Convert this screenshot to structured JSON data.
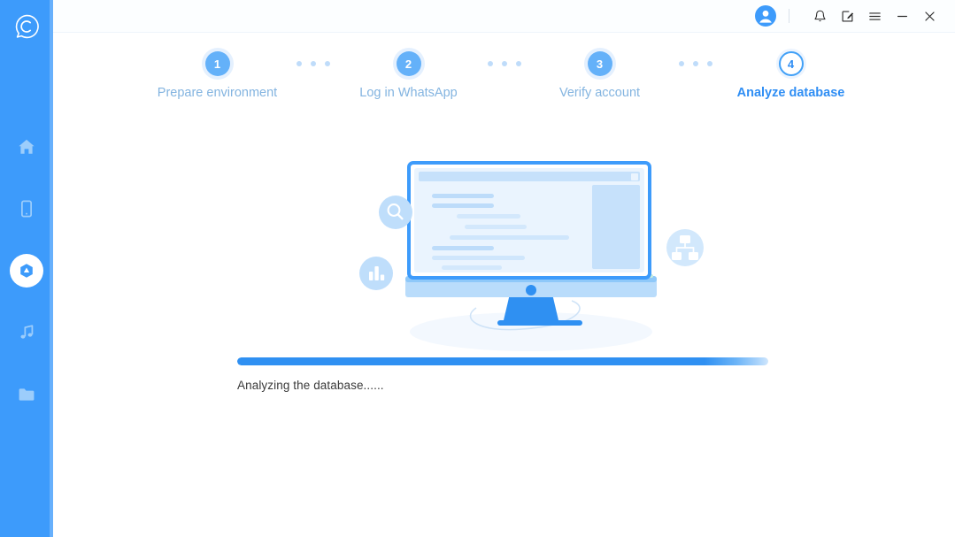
{
  "app": {
    "brand_icon": "chat-c-logo-icon",
    "accent_color": "#3d9bfb",
    "sidebar_color": "#3d9bfb"
  },
  "sidebar": {
    "items": [
      {
        "name": "home",
        "icon": "home-icon",
        "active": false
      },
      {
        "name": "device",
        "icon": "mobile-phone-icon",
        "active": false
      },
      {
        "name": "transfer",
        "icon": "droplet-shield-icon",
        "active": true
      },
      {
        "name": "music",
        "icon": "music-note-icon",
        "active": false
      },
      {
        "name": "files",
        "icon": "folder-icon",
        "active": false
      }
    ]
  },
  "titlebar": {
    "avatar_icon": "user-avatar-icon",
    "buttons": [
      {
        "name": "notifications",
        "icon": "bell-icon"
      },
      {
        "name": "feedback",
        "icon": "note-edit-icon"
      },
      {
        "name": "menu",
        "icon": "hamburger-menu-icon"
      },
      {
        "name": "minimize",
        "icon": "minimize-icon"
      },
      {
        "name": "close",
        "icon": "close-icon"
      }
    ]
  },
  "stepper": {
    "steps": [
      {
        "number": "1",
        "label": "Prepare environment",
        "state": "done"
      },
      {
        "number": "2",
        "label": "Log in WhatsApp",
        "state": "done"
      },
      {
        "number": "3",
        "label": "Verify account",
        "state": "done"
      },
      {
        "number": "4",
        "label": "Analyze database",
        "state": "current"
      }
    ]
  },
  "illustration": {
    "name": "database-analysis-illustration",
    "badges": [
      {
        "name": "search-badge",
        "icon": "search-icon"
      },
      {
        "name": "chart-badge",
        "icon": "bar-chart-icon"
      },
      {
        "name": "hierarchy-badge",
        "icon": "sitemap-icon"
      }
    ]
  },
  "progress": {
    "status_text": "Analyzing the database......",
    "percent": 93,
    "fill_color": "#2f90f2",
    "track_color": "#eef3f8"
  }
}
